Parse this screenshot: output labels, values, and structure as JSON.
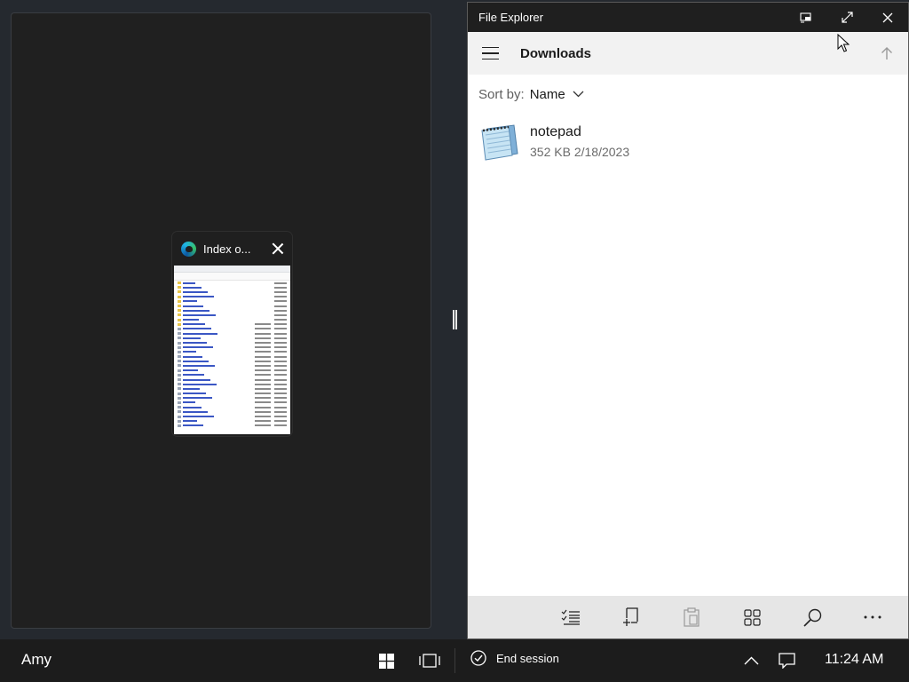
{
  "left_pane": {
    "thumbnail": {
      "title": "Index o...",
      "close_label": "close",
      "app_icon": "edge-icon"
    }
  },
  "file_explorer": {
    "title": "File Explorer",
    "titlebar_buttons": [
      "compact-overlay-icon",
      "fullscreen-icon",
      "close-icon"
    ],
    "nav": {
      "menu_icon": "hamburger-icon",
      "location": "Downloads",
      "up_icon": "arrow-up-icon"
    },
    "sort": {
      "label": "Sort by:",
      "value": "Name"
    },
    "files": [
      {
        "name": "notepad",
        "size": "352 KB",
        "date": "2/18/2023",
        "icon": "notepad-file-icon"
      }
    ],
    "bottom_toolbar": [
      "select-multiple-icon",
      "new-item-icon",
      "paste-icon",
      "view-grid-icon",
      "search-icon",
      "more-icon"
    ]
  },
  "taskbar": {
    "user": "Amy",
    "end_session": "End session",
    "clock": "11:24 AM",
    "icons": [
      "windows-start-icon",
      "task-view-icon",
      "check-circle-icon",
      "chevron-up-icon",
      "notification-icon"
    ]
  }
}
